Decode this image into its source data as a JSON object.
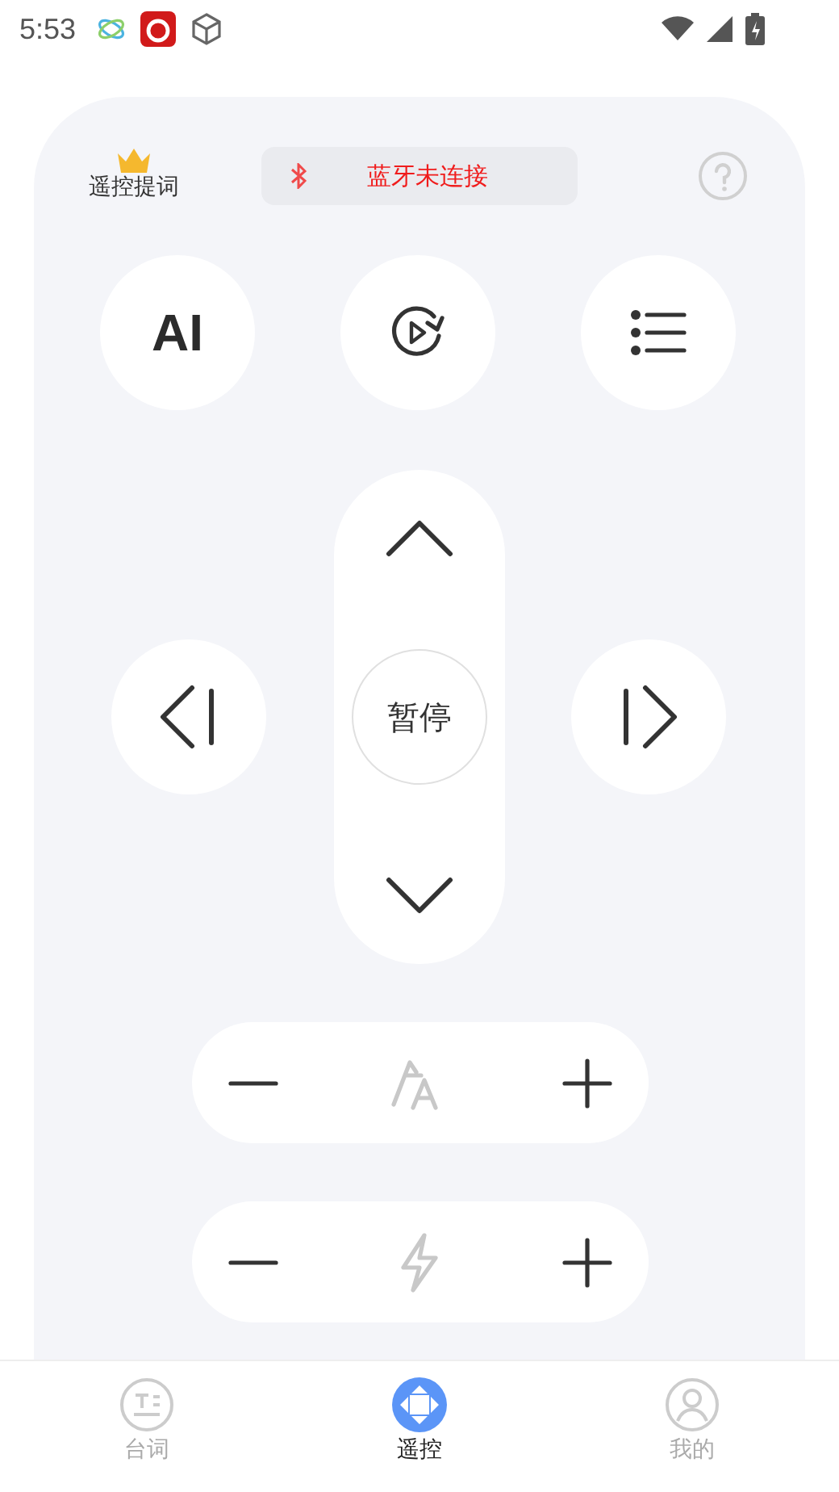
{
  "status_bar": {
    "time": "5:53"
  },
  "header": {
    "vip_label": "遥控提词",
    "bluetooth_status": "蓝牙未连接"
  },
  "shortcuts": {
    "ai_label": "AI"
  },
  "dpad": {
    "center_label": "暂停"
  },
  "tabs": [
    {
      "label": "台词",
      "selected": false
    },
    {
      "label": "遥控",
      "selected": true
    },
    {
      "label": "我的",
      "selected": false
    }
  ]
}
